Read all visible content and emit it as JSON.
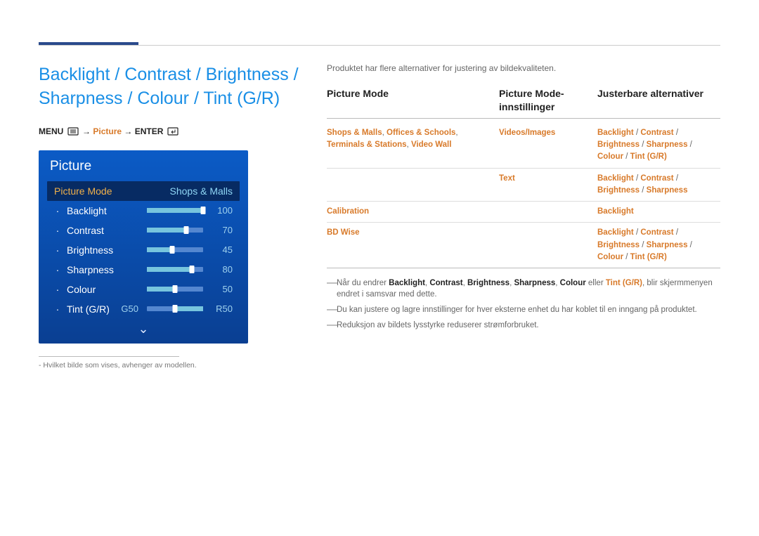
{
  "heading": "Backlight / Contrast / Brightness / Sharpness / Colour / Tint (G/R)",
  "breadcrumb": {
    "menu": "MENU",
    "picture": "Picture",
    "enter": "ENTER",
    "arrow": "→"
  },
  "osd": {
    "title": "Picture",
    "selected": {
      "label": "Picture Mode",
      "value": "Shops & Malls"
    },
    "items": [
      {
        "label": "Backlight",
        "value": 100,
        "percent": 100
      },
      {
        "label": "Contrast",
        "value": 70,
        "percent": 70
      },
      {
        "label": "Brightness",
        "value": 45,
        "percent": 45
      },
      {
        "label": "Sharpness",
        "value": 80,
        "percent": 80
      },
      {
        "label": "Colour",
        "value": 50,
        "percent": 50
      }
    ],
    "tint": {
      "label": "Tint (G/R)",
      "left": "G50",
      "right": "R50",
      "percent": 50
    }
  },
  "footnote_prefix": "-",
  "footnote": "Hvilket bilde som vises, avhenger av modellen.",
  "intro": "Produktet har flere alternativer for justering av bildekvaliteten.",
  "table": {
    "headers": {
      "col1": "Picture Mode",
      "col2": "Picture Mode-innstillinger",
      "col3": "Justerbare alternativer"
    },
    "rows": [
      {
        "col1": [
          {
            "t": "Shops & Malls"
          },
          {
            "s": ", "
          },
          {
            "t": "Offices & Schools"
          },
          {
            "s": ", "
          },
          {
            "t": "Terminals & Stations"
          },
          {
            "s": ", "
          },
          {
            "t": "Video Wall"
          }
        ],
        "col2": [
          {
            "t": "Videos/Images"
          }
        ],
        "col3": [
          {
            "t": "Backlight"
          },
          {
            "s": " / "
          },
          {
            "t": "Contrast"
          },
          {
            "s": " / "
          },
          {
            "t": "Brightness"
          },
          {
            "s": " / "
          },
          {
            "t": "Sharpness"
          },
          {
            "s": " / "
          },
          {
            "t": "Colour"
          },
          {
            "s": " / "
          },
          {
            "t": "Tint (G/R)"
          }
        ]
      },
      {
        "col1": [],
        "col2": [
          {
            "t": "Text"
          }
        ],
        "col3": [
          {
            "t": "Backlight"
          },
          {
            "s": " / "
          },
          {
            "t": "Contrast"
          },
          {
            "s": " / "
          },
          {
            "t": "Brightness"
          },
          {
            "s": " / "
          },
          {
            "t": "Sharpness"
          }
        ]
      },
      {
        "col1": [
          {
            "t": "Calibration"
          }
        ],
        "col2": [],
        "col3": [
          {
            "t": "Backlight"
          }
        ]
      },
      {
        "col1": [
          {
            "t": "BD Wise"
          }
        ],
        "col2": [],
        "col3": [
          {
            "t": "Backlight"
          },
          {
            "s": " / "
          },
          {
            "t": "Contrast"
          },
          {
            "s": " / "
          },
          {
            "t": "Brightness"
          },
          {
            "s": " / "
          },
          {
            "t": "Sharpness"
          },
          {
            "s": " / "
          },
          {
            "t": "Colour"
          },
          {
            "s": " / "
          },
          {
            "t": "Tint (G/R)"
          }
        ]
      }
    ]
  },
  "notes": [
    {
      "prefix": "―",
      "segments": [
        {
          "plain": "Når du endrer "
        },
        {
          "term": "Backlight"
        },
        {
          "plain": ", "
        },
        {
          "term": "Contrast"
        },
        {
          "plain": ", "
        },
        {
          "term": "Brightness"
        },
        {
          "plain": ", "
        },
        {
          "term": "Sharpness"
        },
        {
          "plain": ", "
        },
        {
          "term": "Colour"
        },
        {
          "plain": " eller "
        },
        {
          "hot": "Tint (G/R)"
        },
        {
          "plain": ", blir skjermmenyen endret i samsvar med dette."
        }
      ]
    },
    {
      "prefix": "―",
      "segments": [
        {
          "plain": "Du kan justere og lagre innstillinger for hver eksterne enhet du har koblet til en inngang på produktet."
        }
      ]
    },
    {
      "prefix": "―",
      "segments": [
        {
          "plain": "Reduksjon av bildets lysstyrke reduserer strømforbruket."
        }
      ]
    }
  ]
}
